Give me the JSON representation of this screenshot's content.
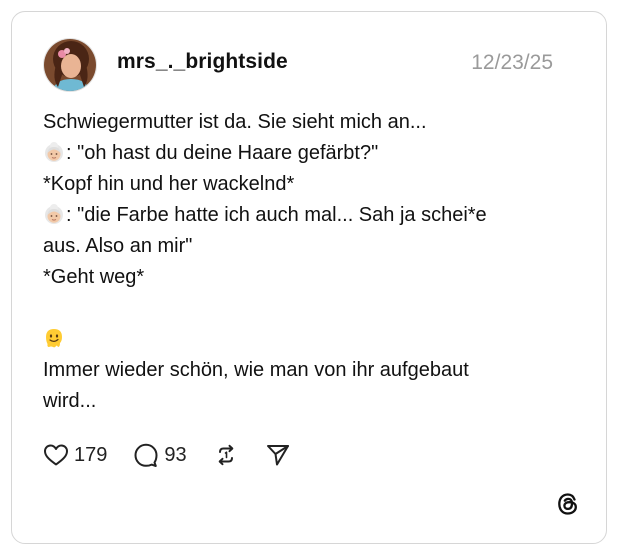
{
  "post": {
    "username": "mrs_._brightside",
    "date": "12/23/25",
    "lines": {
      "l1": "Schwiegermutter ist da. Sie sieht mich an...",
      "l2": ": \"oh hast du deine Haare gefärbt?\"",
      "l3": "*Kopf hin und her wackelnd*",
      "l4": ": \"die Farbe hatte ich auch mal... Sah ja schei*e",
      "l5": "aus. Also an mir\"",
      "l6": "*Geht weg*",
      "l8": "Immer wieder schön, wie man von ihr aufgebaut",
      "l9": "wird..."
    },
    "stats": {
      "likes": "179",
      "comments": "93"
    }
  },
  "icons": {
    "avatar": "avatar-photo",
    "grandma": "older-woman-emoji-icon",
    "melting": "melting-face-emoji-icon",
    "like": "heart-icon",
    "comment": "comment-bubble-icon",
    "repost": "repost-icon",
    "share": "send-icon",
    "brand": "threads-logo-icon"
  },
  "colors": {
    "text": "#111111",
    "muted": "#9a9a9a",
    "border": "#d6d6d6"
  }
}
